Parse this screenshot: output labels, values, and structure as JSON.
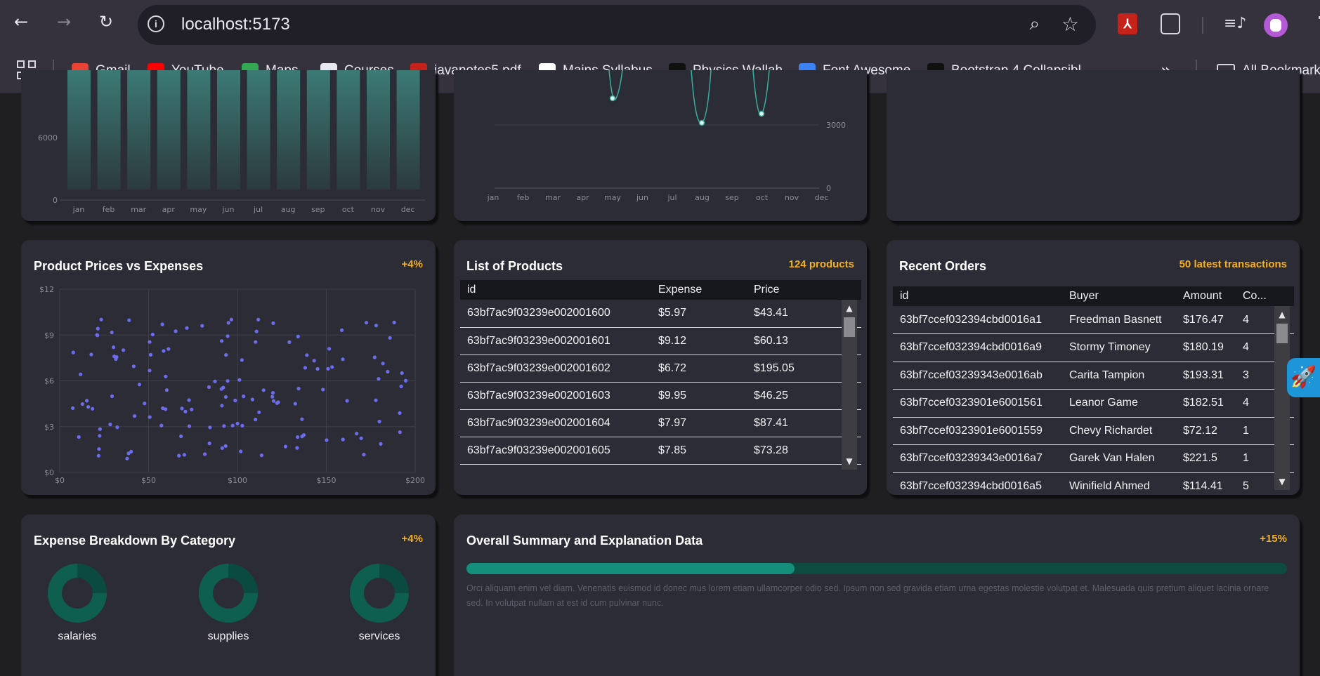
{
  "browser": {
    "url": "localhost:5173",
    "back_icon": "arrow-left-icon",
    "forward_icon": "arrow-right-icon",
    "reload_icon": "reload-icon",
    "bookmarks": [
      {
        "label": "Gmail",
        "icon": "gmail-icon",
        "color": "#ea4335"
      },
      {
        "label": "YouTube",
        "icon": "youtube-icon",
        "color": "#ff0000"
      },
      {
        "label": "Maps",
        "icon": "maps-icon",
        "color": "#34a853"
      },
      {
        "label": "Courses",
        "icon": "courses-icon",
        "color": "#e8e8f0"
      },
      {
        "label": "javanotes5.pdf",
        "icon": "pdf-icon",
        "color": "#c4221b"
      },
      {
        "label": "Mains Syllabus",
        "icon": "syllabus-icon",
        "color": "#ffffff"
      },
      {
        "label": "Physics Wallah",
        "icon": "pw-icon",
        "color": "#111111"
      },
      {
        "label": "Font Awesome",
        "icon": "font-awesome-flag-icon",
        "color": "#3b82f6"
      },
      {
        "label": "Bootstrap 4 Collapsibl...",
        "icon": "bootstrap-icon",
        "color": "#111111"
      }
    ],
    "all_bookmarks": "All Bookmarks"
  },
  "top_charts": {
    "left": {
      "type": "bar",
      "y_ticks": [
        "0",
        "6000"
      ],
      "categories": [
        "jan",
        "feb",
        "mar",
        "apr",
        "may",
        "jun",
        "jul",
        "aug",
        "sep",
        "oct",
        "nov",
        "dec"
      ]
    },
    "middle": {
      "type": "line",
      "y_ticks": [
        "0",
        "3000"
      ],
      "categories": [
        "jan",
        "feb",
        "mar",
        "apr",
        "may",
        "jun",
        "jul",
        "aug",
        "sep",
        "oct",
        "nov",
        "dec"
      ]
    }
  },
  "scatter_card": {
    "title": "Product Prices vs Expenses",
    "badge": "+4%",
    "y_ticks": [
      "$0",
      "$3",
      "$6",
      "$9",
      "$12"
    ],
    "x_ticks": [
      "$0",
      "$50",
      "$100",
      "$150",
      "$200"
    ],
    "point_color": "#6d6cf0"
  },
  "products_card": {
    "title": "List of Products",
    "badge": "124 products",
    "columns": [
      "id",
      "Expense",
      "Price"
    ],
    "rows": [
      [
        "63bf7ac9f03239e002001600",
        "$5.97",
        "$43.41"
      ],
      [
        "63bf7ac9f03239e002001601",
        "$9.12",
        "$60.13"
      ],
      [
        "63bf7ac9f03239e002001602",
        "$6.72",
        "$195.05"
      ],
      [
        "63bf7ac9f03239e002001603",
        "$9.95",
        "$46.25"
      ],
      [
        "63bf7ac9f03239e002001604",
        "$7.97",
        "$87.41"
      ],
      [
        "63bf7ac9f03239e002001605",
        "$7.85",
        "$73.28"
      ]
    ]
  },
  "orders_card": {
    "title": "Recent Orders",
    "badge": "50 latest transactions",
    "columns": [
      "id",
      "Buyer",
      "Amount",
      "Co..."
    ],
    "rows": [
      [
        "63bf7ccef032394cbd0016a1",
        "Freedman Basnett",
        "$176.47",
        "4"
      ],
      [
        "63bf7ccef032394cbd0016a9",
        "Stormy Timoney",
        "$180.19",
        "4"
      ],
      [
        "63bf7ccef03239343e0016ab",
        "Carita Tampion",
        "$193.31",
        "3"
      ],
      [
        "63bf7ccef0323901e6001561",
        "Leanor Game",
        "$182.51",
        "4"
      ],
      [
        "63bf7ccef0323901e6001559",
        "Chevy Richardet",
        "$72.12",
        "1"
      ],
      [
        "63bf7ccef03239343e0016a7",
        "Garek Van Halen",
        "$221.5",
        "1"
      ],
      [
        "63bf7ccef032394cbd0016a5",
        "Winifield Ahmed",
        "$114.41",
        "5"
      ]
    ]
  },
  "breakdown_card": {
    "title": "Expense Breakdown By Category",
    "badge": "+4%",
    "categories": [
      {
        "label": "salaries",
        "fraction": 0.75
      },
      {
        "label": "supplies",
        "fraction": 0.75
      },
      {
        "label": "services",
        "fraction": 0.75
      }
    ]
  },
  "summary_card": {
    "title": "Overall Summary and Explanation Data",
    "badge": "+15%",
    "progress": 0.4,
    "text": "Orci aliquam enim vel diam. Venenatis euismod id donec mus lorem etiam ullamcorper odio sed. Ipsum non sed gravida etiam urna egestas molestie volutpat et. Malesuada quis pretium aliquet lacinia ornare sed. In volutpat nullam at est id cum pulvinar nunc."
  },
  "colors": {
    "accent_orange": "#f5b021",
    "teal": "#1f6f5f",
    "teal_light": "#0f9480",
    "card_bg": "#2b2c35"
  }
}
